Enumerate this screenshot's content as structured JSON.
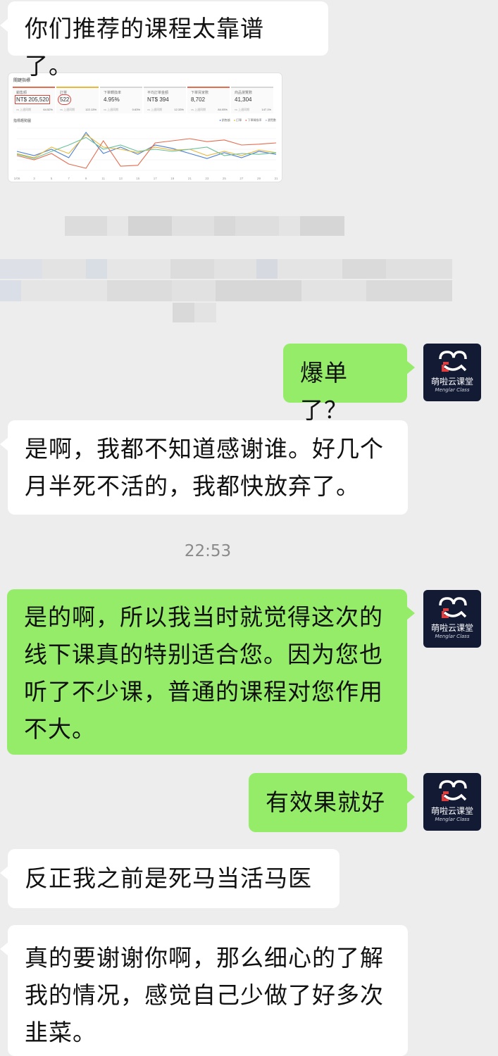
{
  "colors": {
    "background": "#ededed",
    "incoming_bubble": "#ffffff",
    "outgoing_bubble": "#95ec69",
    "avatar_bg": "#121a34",
    "avatar_accent": "#e23c3c",
    "chart_blue": "#4a7fd4",
    "chart_yellow": "#e9b93b",
    "chart_orange": "#e46c4f",
    "chart_green": "#6ac09a"
  },
  "avatar": {
    "name": "萌啦云课堂",
    "subtitle": "Menglar Class",
    "icon": "menglar-logo-icon"
  },
  "messages": [
    {
      "side": "in",
      "text": "你们推荐的课程太靠谱了。"
    },
    {
      "side": "out",
      "text": "爆单了？"
    },
    {
      "side": "in",
      "text": "是啊，我都不知道感谢谁。好几个\n月半死不活的，我都快放弃了。"
    },
    {
      "side": "out",
      "text": "是的啊，所以我当时就觉得这次的\n线下课真的特别适合您。因为您也\n听了不少课，普通的课程对您作用\n不大。"
    },
    {
      "side": "out",
      "text": "有效果就好"
    },
    {
      "side": "in",
      "text": "反正我之前是死马当活马医"
    },
    {
      "side": "in",
      "text": "真的要谢谢你啊，那么细心的了解\n我的情况，感觉自己少做了好多次\n韭菜。"
    }
  ],
  "timestamp": "22:53",
  "dashboard": {
    "title": "關鍵指標",
    "kpis": [
      {
        "label": "銷售額",
        "value": "NT$ 205,520",
        "foot": "vs 上週同期",
        "delta": "64.52%"
      },
      {
        "label": "訂單",
        "value": "522",
        "foot": "vs 上週同期",
        "delta": "122.13%"
      },
      {
        "label": "下單轉換率",
        "value": "4.95%",
        "foot": "vs 上週同期",
        "delta": "0.63%"
      },
      {
        "label": "平均訂單金額",
        "value": "NT$ 394",
        "foot": "vs 上週同期",
        "delta": "12.33%"
      },
      {
        "label": "下單買家數",
        "value": "8,702",
        "foot": "vs 上週同期",
        "delta": "84.05%"
      },
      {
        "label": "商品瀏覽數",
        "value": "41,304",
        "foot": "vs 上週同期",
        "delta": "147.1%"
      }
    ],
    "trend_title": "指標趨勢圖",
    "legend": [
      "銷售額",
      "訂單",
      "下單轉換率",
      "瀏覽數"
    ],
    "x_ticks": [
      "1/06",
      "3",
      "5",
      "7",
      "9",
      "11",
      "13",
      "15",
      "17",
      "19",
      "21",
      "23",
      "25",
      "27",
      "29",
      "31"
    ]
  },
  "chart_data": {
    "type": "line",
    "title": "指標趨勢圖",
    "categories": [
      "1/06",
      "3",
      "5",
      "7",
      "9",
      "11",
      "13",
      "15",
      "17",
      "19",
      "21",
      "23",
      "25",
      "27",
      "29",
      "31"
    ],
    "ylim": [
      0,
      100
    ],
    "series": [
      {
        "name": "銷售額",
        "color": "#4a7fd4",
        "values": [
          45,
          35,
          50,
          30,
          90,
          40,
          55,
          38,
          60,
          52,
          40,
          28,
          42,
          30,
          45,
          38
        ]
      },
      {
        "name": "訂單",
        "color": "#e9b93b",
        "values": [
          40,
          30,
          55,
          40,
          85,
          55,
          50,
          42,
          55,
          48,
          50,
          35,
          45,
          35,
          48,
          42
        ]
      },
      {
        "name": "下單轉換率",
        "color": "#e46c4f",
        "values": [
          35,
          25,
          40,
          15,
          5,
          70,
          10,
          12,
          65,
          70,
          75,
          68,
          72,
          60,
          62,
          65
        ]
      },
      {
        "name": "瀏覽數",
        "color": "#6ac09a",
        "values": [
          38,
          28,
          45,
          60,
          78,
          50,
          60,
          45,
          50,
          45,
          50,
          55,
          35,
          40,
          38,
          42
        ]
      }
    ]
  }
}
